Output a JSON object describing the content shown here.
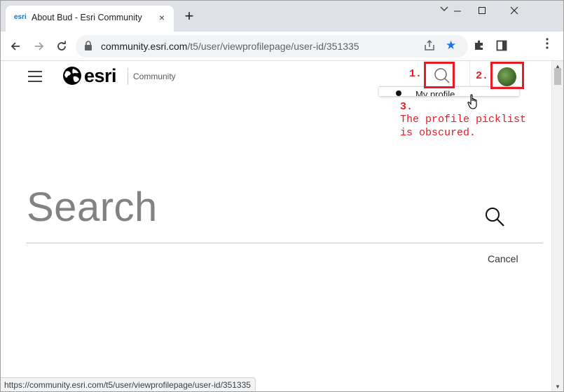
{
  "browser": {
    "tab": {
      "favicon_text": "esri",
      "title": "About Bud - Esri Community",
      "close": "×"
    },
    "new_tab": "+",
    "address": {
      "host": "community.esri.com",
      "path": "/t5/user/viewprofilepage/user-id/351335"
    },
    "status_url": "https://community.esri.com/t5/user/viewprofilepage/user-id/351335",
    "accent_color": "#1a73e8"
  },
  "header": {
    "logo_text": "esri",
    "community_label": "Community",
    "profile_menu_item": "My profile"
  },
  "annotations": {
    "color": "#e41c24",
    "label_1": "1.",
    "label_2": "2.",
    "label_3": "3.",
    "note_line_1": "The profile picklist",
    "note_line_2": "is obscured."
  },
  "search_panel": {
    "heading": "Search",
    "cancel_label": "Cancel"
  },
  "icons": {
    "menu": "hamburger-icon",
    "search": "search-icon",
    "avatar": "avatar-image",
    "cursor": "hand-pointer-icon"
  }
}
